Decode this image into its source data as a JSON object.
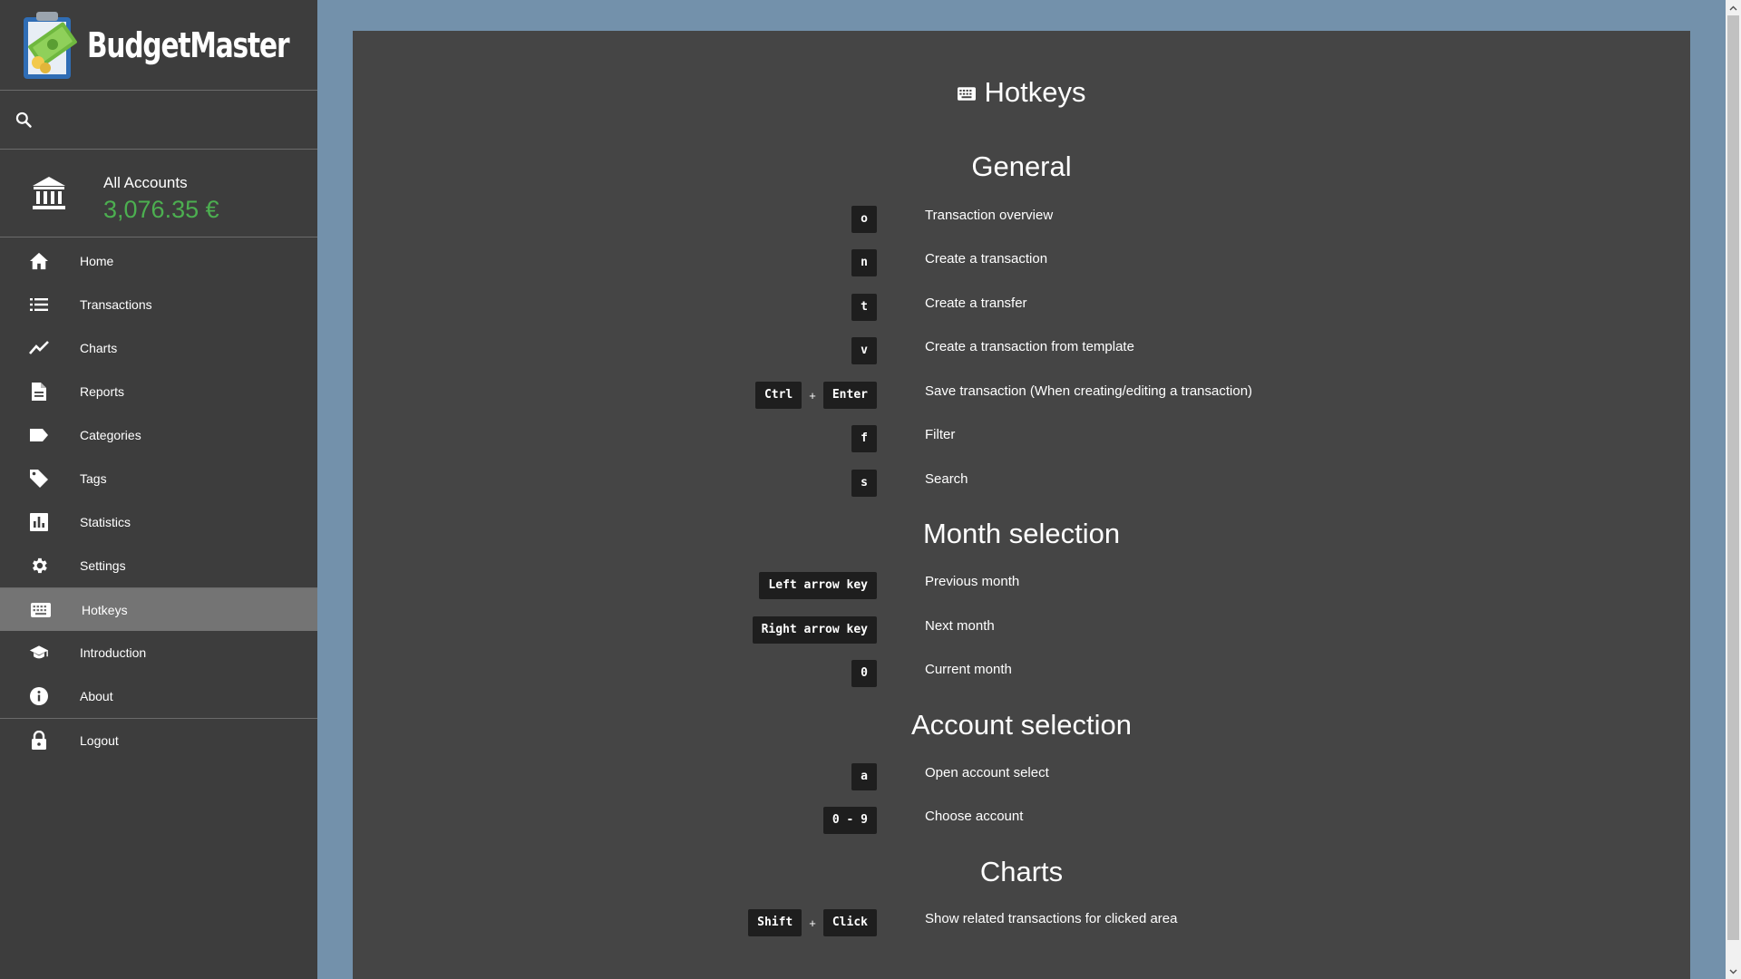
{
  "app": {
    "name": "BudgetMaster"
  },
  "account": {
    "name": "All Accounts",
    "balance": "3,076.35 €",
    "balance_color": "#4caf50"
  },
  "sidebar": {
    "items": [
      {
        "label": "Home",
        "icon": "home-icon"
      },
      {
        "label": "Transactions",
        "icon": "list-icon"
      },
      {
        "label": "Charts",
        "icon": "line-chart-icon"
      },
      {
        "label": "Reports",
        "icon": "document-icon"
      },
      {
        "label": "Categories",
        "icon": "label-icon"
      },
      {
        "label": "Tags",
        "icon": "tag-icon"
      },
      {
        "label": "Statistics",
        "icon": "bar-chart-icon"
      },
      {
        "label": "Settings",
        "icon": "gear-icon"
      },
      {
        "label": "Hotkeys",
        "icon": "keyboard-icon",
        "active": true
      },
      {
        "label": "Introduction",
        "icon": "graduation-cap-icon"
      },
      {
        "label": "About",
        "icon": "info-icon"
      },
      {
        "label": "Logout",
        "icon": "lock-icon"
      }
    ]
  },
  "page": {
    "title": "Hotkeys"
  },
  "sections": [
    {
      "title": "General",
      "hotkeys": [
        {
          "keys": [
            "o"
          ],
          "desc": "Transaction overview"
        },
        {
          "keys": [
            "n"
          ],
          "desc": "Create a transaction"
        },
        {
          "keys": [
            "t"
          ],
          "desc": "Create a transfer"
        },
        {
          "keys": [
            "v"
          ],
          "desc": "Create a transaction from template"
        },
        {
          "keys": [
            "Ctrl",
            "Enter"
          ],
          "desc": "Save transaction (When creating/editing a transaction)"
        },
        {
          "keys": [
            "f"
          ],
          "desc": "Filter"
        },
        {
          "keys": [
            "s"
          ],
          "desc": "Search"
        }
      ]
    },
    {
      "title": "Month selection",
      "hotkeys": [
        {
          "keys": [
            "Left arrow key"
          ],
          "desc": "Previous month"
        },
        {
          "keys": [
            "Right arrow key"
          ],
          "desc": "Next month"
        },
        {
          "keys": [
            "0"
          ],
          "desc": "Current month"
        }
      ]
    },
    {
      "title": "Account selection",
      "hotkeys": [
        {
          "keys": [
            "a"
          ],
          "desc": "Open account select"
        },
        {
          "keys": [
            "0 - 9"
          ],
          "desc": "Choose account"
        }
      ]
    },
    {
      "title": "Charts",
      "hotkeys": [
        {
          "keys": [
            "Shift",
            "Click"
          ],
          "desc": "Show related transactions for clicked area"
        }
      ]
    }
  ],
  "key_separator": "+"
}
